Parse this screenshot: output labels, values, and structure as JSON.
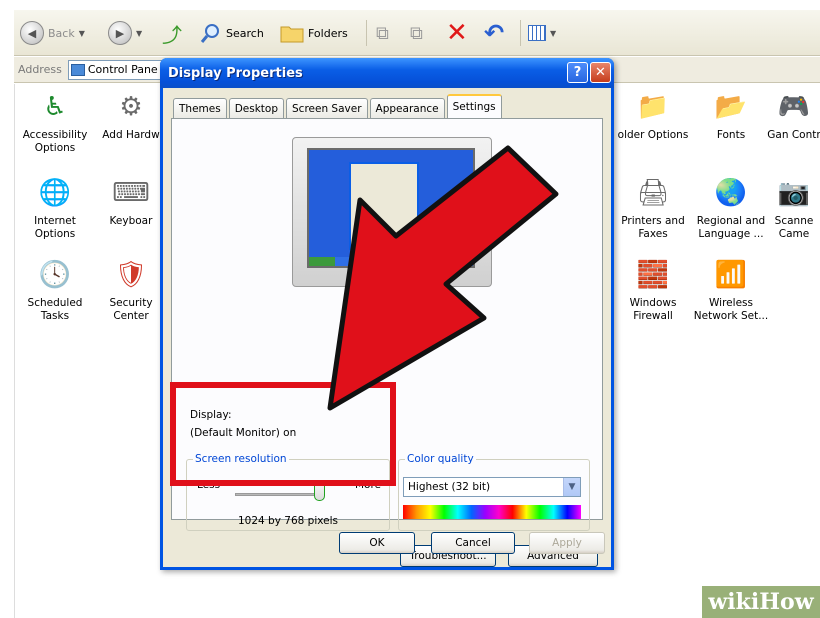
{
  "toolbar": {
    "back_label": "Back",
    "search_label": "Search",
    "folders_label": "Folders"
  },
  "address": {
    "label": "Address",
    "value": "Control Pane"
  },
  "control_panel": {
    "items": [
      {
        "label": "Accessibility Options",
        "icon": "accessibility-icon"
      },
      {
        "label": "Add Hardw",
        "icon": "add-hardware-icon"
      },
      {
        "label": "Internet Options",
        "icon": "internet-options-icon"
      },
      {
        "label": "Keyboar",
        "icon": "keyboard-icon"
      },
      {
        "label": "Scheduled Tasks",
        "icon": "scheduled-tasks-icon"
      },
      {
        "label": "Security Center",
        "icon": "security-center-icon"
      },
      {
        "label": "older Options",
        "icon": "folder-options-icon"
      },
      {
        "label": "Fonts",
        "icon": "fonts-icon"
      },
      {
        "label": "Gan Contr",
        "icon": "game-controllers-icon"
      },
      {
        "label": "Printers and Faxes",
        "icon": "printers-icon"
      },
      {
        "label": "Regional and Language ...",
        "icon": "regional-icon"
      },
      {
        "label": "Scanne Came",
        "icon": "scanners-icon"
      },
      {
        "label": "Windows Firewall",
        "icon": "firewall-icon"
      },
      {
        "label": "Wireless Network Set...",
        "icon": "wireless-icon"
      }
    ]
  },
  "dialog": {
    "title": "Display Properties",
    "help_label": "?",
    "close_label": "✕",
    "tabs": [
      {
        "label": "Themes"
      },
      {
        "label": "Desktop"
      },
      {
        "label": "Screen Saver"
      },
      {
        "label": "Appearance"
      },
      {
        "label": "Settings",
        "active": true
      }
    ],
    "display_label": "Display:",
    "display_value": "(Default Monitor) on",
    "resolution": {
      "legend": "Screen resolution",
      "less": "Less",
      "more": "More",
      "value_text": "1024 by 768 pixels",
      "slider_fraction": 0.95
    },
    "color_quality": {
      "legend": "Color quality",
      "selected": "Highest (32 bit)"
    },
    "buttons": {
      "troubleshoot": "Troubleshoot...",
      "advanced": "Advanced",
      "ok": "OK",
      "cancel": "Cancel",
      "apply": "Apply"
    }
  },
  "watermark": "wikiHow",
  "colors": {
    "highlight": "#e0101a",
    "titlebar": "#0a5ee6",
    "dialog_bg": "#ece9d8"
  }
}
